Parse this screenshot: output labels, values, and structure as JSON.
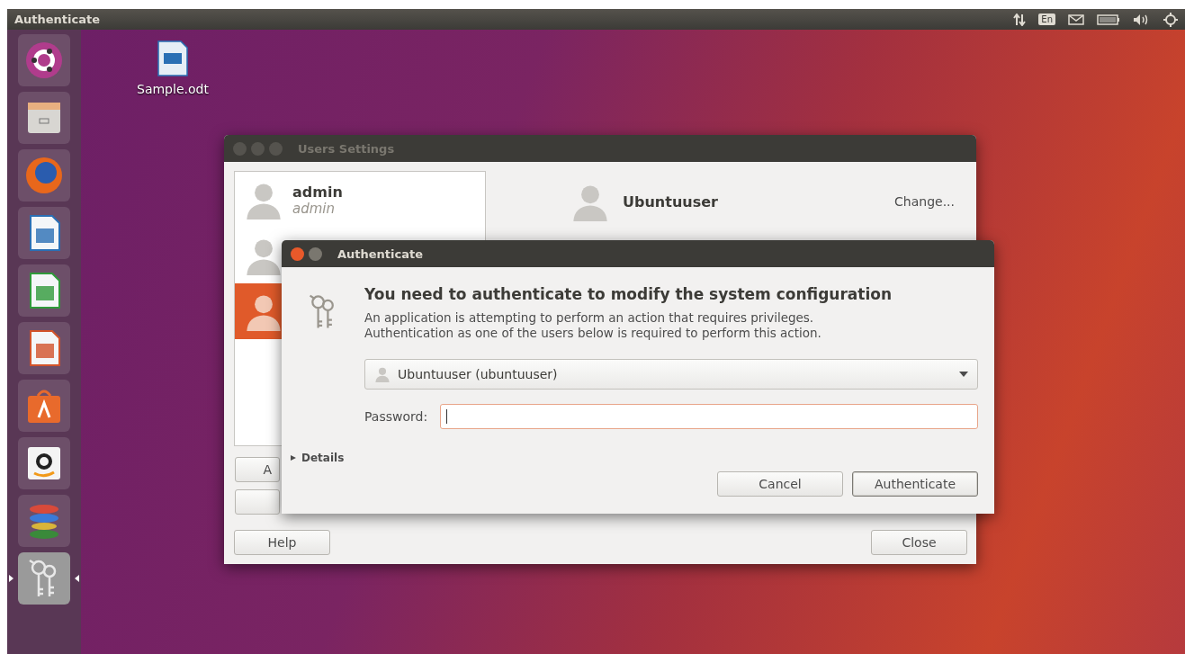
{
  "top_bar": {
    "title": "Authenticate",
    "keyboard_layout": "En"
  },
  "launcher": {
    "items": [
      {
        "kind": "dash",
        "focused": false
      },
      {
        "kind": "files",
        "focused": false
      },
      {
        "kind": "browser",
        "focused": false
      },
      {
        "kind": "writer",
        "focused": false
      },
      {
        "kind": "calc",
        "focused": false
      },
      {
        "kind": "impress",
        "focused": false
      },
      {
        "kind": "store",
        "focused": false
      },
      {
        "kind": "amazon",
        "focused": false
      },
      {
        "kind": "stack",
        "focused": false
      },
      {
        "kind": "keys",
        "focused": true
      }
    ]
  },
  "desktop_icons": [
    {
      "label": "Sample.odt"
    }
  ],
  "users_window": {
    "title": "Users Settings",
    "users": [
      {
        "name": "admin",
        "login": "admin",
        "selected": false
      },
      {
        "selected": false
      },
      {
        "selected": true
      }
    ],
    "list_buttons": [
      "A"
    ],
    "detail": {
      "name": "Ubuntuuser",
      "action": "Change..."
    },
    "help": "Help",
    "close": "Close"
  },
  "auth_dialog": {
    "title": "Authenticate",
    "heading": "You need to authenticate to modify the system configuration",
    "message": [
      "An application is attempting to perform an action that requires privileges.",
      "Authentication as one of the users below is required to perform this action."
    ],
    "identity": "Ubuntuuser (ubuntuuser)",
    "password_label": "Password:",
    "details": {
      "label": "Details",
      "expanded": false
    },
    "buttons": [
      {
        "label": "Cancel",
        "default": false
      },
      {
        "label": "Authenticate",
        "default": true
      }
    ]
  }
}
